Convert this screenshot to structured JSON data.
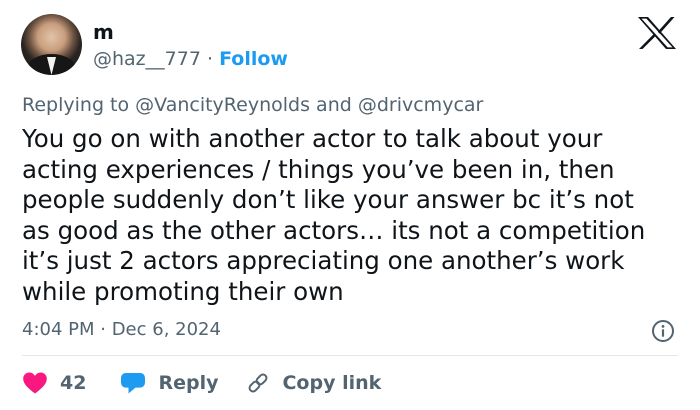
{
  "author": {
    "name": "m",
    "handle": "@haz__777",
    "separator": "·",
    "follow_label": "Follow"
  },
  "reply_context": {
    "prefix": "Replying to",
    "mention1": "@VancityReynolds",
    "conjunction": "and",
    "mention2": "@drivcmycar"
  },
  "tweet": {
    "lines": [
      "You go on with another actor to talk about your",
      "acting experiences / things you’ve been in, then",
      "people suddenly don’t like your answer bc it’s not",
      "as good as the other actors… its not a competition",
      "it’s just 2 actors appreciating one another’s work",
      "while promoting their own"
    ]
  },
  "meta": {
    "timestamp": "4:04 PM · Dec 6, 2024"
  },
  "actions": {
    "like_count": "42",
    "reply_label": "Reply",
    "copy_label": "Copy link"
  },
  "colors": {
    "text": "#0f1419",
    "secondary": "#536471",
    "link": "#1d9bf0",
    "like": "#f91880",
    "reply_icon": "#1d9bf0",
    "divider": "#e1e8ed"
  },
  "icons": {
    "logo": "x-logo-icon",
    "info": "info-icon",
    "like": "heart-icon",
    "reply": "speech-bubble-icon",
    "copy": "link-icon"
  }
}
